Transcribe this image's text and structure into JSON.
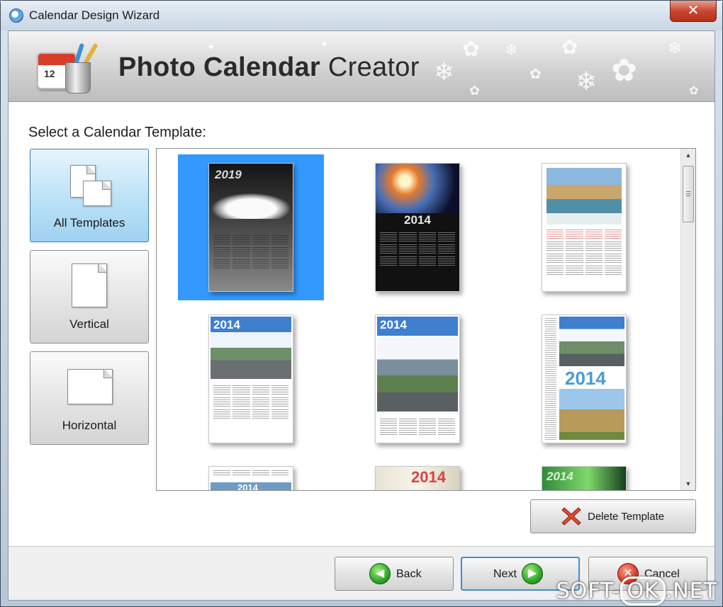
{
  "window": {
    "title": "Calendar Design Wizard",
    "close_label": "✕"
  },
  "banner": {
    "brand_bold": "Photo Calendar",
    "brand_light": "Creator",
    "logo_day": "12"
  },
  "section": {
    "label": "Select a Calendar Template:"
  },
  "categories": [
    {
      "label": "All Templates",
      "active": true
    },
    {
      "label": "Vertical",
      "active": false
    },
    {
      "label": "Horizontal",
      "active": false
    }
  ],
  "templates": [
    {
      "year": "2019"
    },
    {
      "year": "2014"
    },
    {
      "year": ""
    },
    {
      "year": "2014"
    },
    {
      "year": "2014"
    },
    {
      "year": "2014"
    },
    {
      "year": "2014"
    },
    {
      "year": "2014"
    },
    {
      "year": "2014"
    }
  ],
  "actions": {
    "delete_label": "Delete Template",
    "back_label": "Back",
    "next_label": "Next",
    "cancel_label": "Cancel"
  },
  "watermark": {
    "left": "SOFT-",
    "middle": "OK",
    "right": ".NET"
  },
  "colors": {
    "selection": "#3399ff",
    "accent_green": "#2ea52a",
    "accent_red": "#d8392a"
  }
}
